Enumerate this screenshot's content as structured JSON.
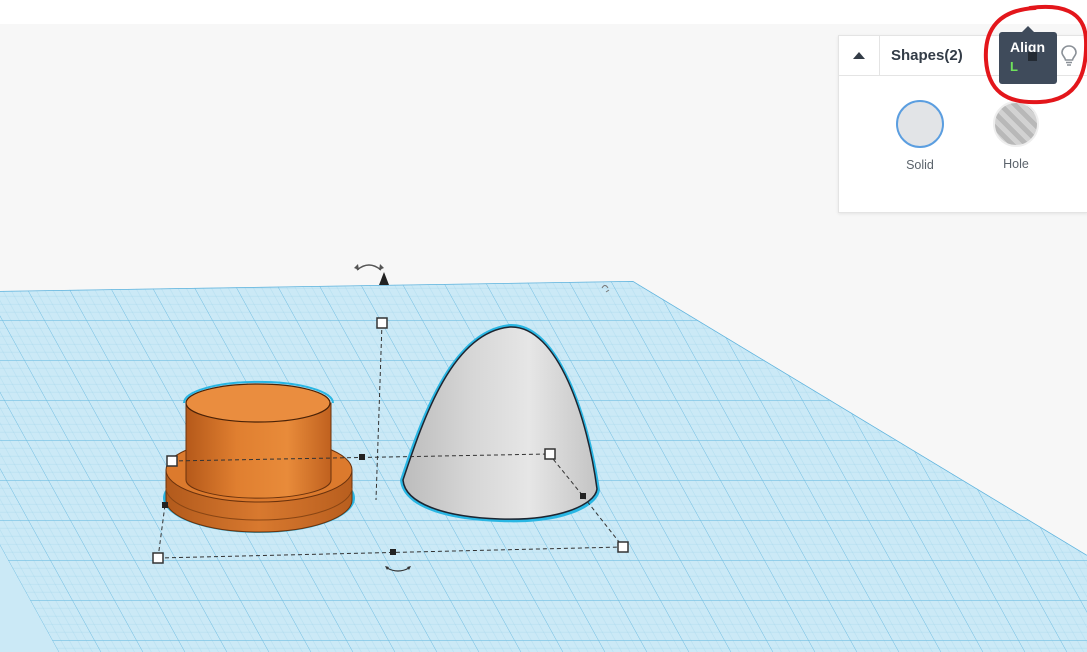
{
  "panel": {
    "title": "Shapes(2)",
    "options": [
      {
        "label": "Solid",
        "color": "#e2e4e7"
      },
      {
        "label": "Hole",
        "color": "#c6c6c6"
      }
    ]
  },
  "tooltip": {
    "label": "Align",
    "shortcut": "L"
  },
  "icons": [
    "collapse-arrow-icon",
    "lightbulb-icon",
    "rotate-arrow-icon"
  ],
  "colors": {
    "grid": "#b9dff0",
    "grid_major": "#85c6e4",
    "selection_outline": "#29b6e3",
    "cylinder": "#e88b3a",
    "paraboloid": "#d9d9d9",
    "tooltip_bg": "#3f4b5b",
    "annotation": "#e3161b"
  }
}
